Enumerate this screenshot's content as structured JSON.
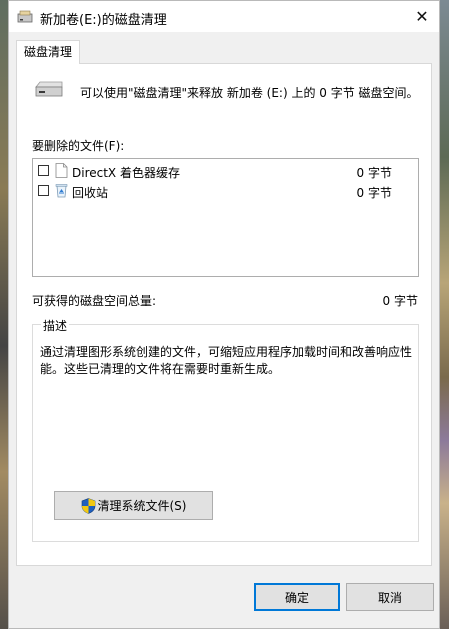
{
  "window": {
    "title": "新加卷(E:)的磁盘清理",
    "close_glyph": "✕"
  },
  "tabs": [
    {
      "label": "磁盘清理"
    }
  ],
  "summary": "可以使用\"磁盘清理\"来释放 新加卷 (E:) 上的 0 字节 磁盘空间。",
  "files_label": "要删除的文件(F):",
  "files": [
    {
      "name": "DirectX 着色器缓存",
      "size": "0 字节",
      "checked": false,
      "icon": "blank-file-icon"
    },
    {
      "name": "回收站",
      "size": "0 字节",
      "checked": false,
      "icon": "recycle-bin-icon"
    }
  ],
  "space": {
    "label": "可获得的磁盘空间总量:",
    "value": "0 字节"
  },
  "description": {
    "legend": "描述",
    "text": "通过清理图形系统创建的文件，可缩短应用程序加载时间和改善响应性能。这些已清理的文件将在需要时重新生成。"
  },
  "buttons": {
    "clean_system": "清理系统文件(S)",
    "ok": "确定",
    "cancel": "取消"
  },
  "colors": {
    "accent": "#0078d7",
    "panel": "#ffffff",
    "window_bg": "#f0f0f0"
  }
}
